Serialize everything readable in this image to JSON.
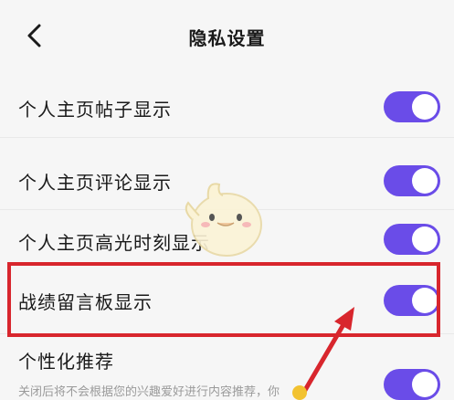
{
  "header": {
    "title": "隐私设置",
    "back_icon": "chevron-left-icon"
  },
  "settings": [
    {
      "label": "个人主页帖子显示",
      "enabled": true
    },
    {
      "label": "个人主页评论显示",
      "enabled": true
    },
    {
      "label": "个人主页高光时刻显示",
      "enabled": true
    },
    {
      "label": "战绩留言板显示",
      "enabled": true
    },
    {
      "label": "个性化推荐",
      "description": "关闭后将不会根据您的兴趣爱好进行内容推荐，你",
      "enabled": true
    }
  ],
  "colors": {
    "toggle_on": "#6a4ce8",
    "highlight": "#d8262d",
    "background": "#f6f6f6"
  }
}
